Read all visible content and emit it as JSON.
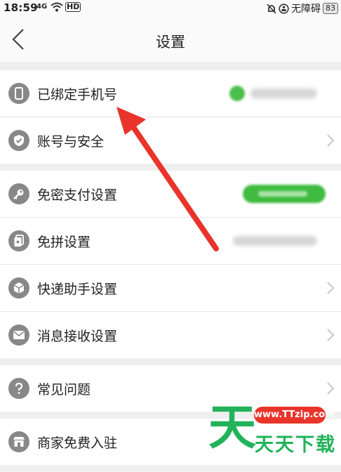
{
  "status_bar": {
    "time": "18:59",
    "signal": "4G",
    "hd": "HD",
    "carrier_text": "无障碍",
    "battery": "83"
  },
  "nav": {
    "title": "设置",
    "back_icon": "chevron-left-icon"
  },
  "groups": [
    {
      "items": [
        {
          "label": "已绑定手机号",
          "icon": "phone-icon",
          "value": "blurred-phone-number"
        },
        {
          "label": "账号与安全",
          "icon": "shield-check-icon"
        }
      ]
    },
    {
      "items": [
        {
          "label": "免密支付设置",
          "icon": "key-icon",
          "value": "blurred-green-status"
        },
        {
          "label": "免拼设置",
          "icon": "cards-icon",
          "value": "blurred-text"
        },
        {
          "label": "快递助手设置",
          "icon": "package-icon"
        },
        {
          "label": "消息接收设置",
          "icon": "mail-icon"
        }
      ]
    },
    {
      "items": [
        {
          "label": "常见问题",
          "icon": "question-icon"
        }
      ]
    },
    {
      "items": [
        {
          "label": "商家免费入驻",
          "icon": "store-icon"
        }
      ]
    }
  ],
  "watermark": {
    "big_char": "天",
    "url": "www.TTzip.com",
    "text": "天天下载"
  },
  "colors": {
    "annotation_arrow": "#e8342b",
    "watermark_green": "#22b35a",
    "icon_gray": "#888888"
  }
}
